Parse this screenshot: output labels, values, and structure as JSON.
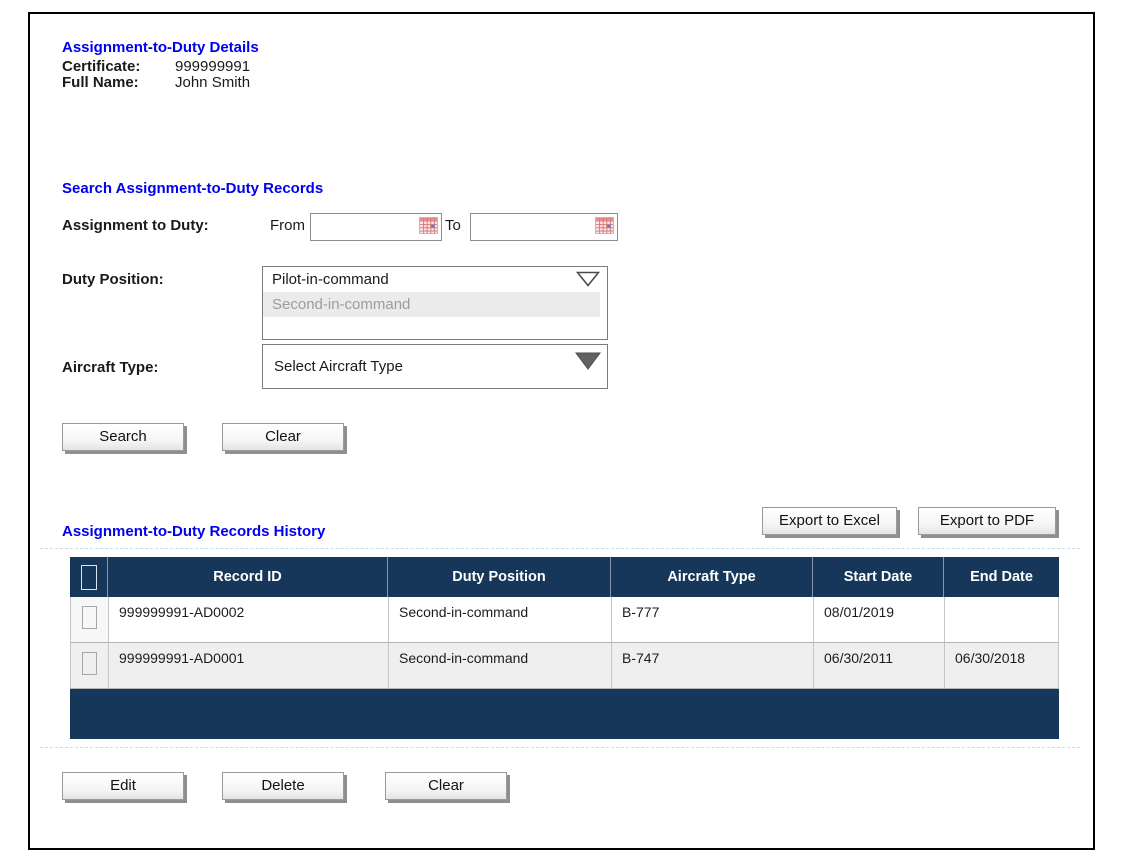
{
  "header": {
    "title": "Assignment-to-Duty Details",
    "certificate_label": "Certificate:",
    "certificate_value": "999999991",
    "full_name_label": "Full Name:",
    "full_name_value": "John Smith"
  },
  "search": {
    "heading": "Search Assignment-to-Duty Records",
    "date_label": "Assignment to Duty:",
    "from_label": "From",
    "from_value": "",
    "to_label": "To",
    "to_value": "",
    "duty_position_label": "Duty Position:",
    "duty_position_selected": "Pilot-in-command",
    "duty_position_option2": "Second-in-command",
    "aircraft_type_label": "Aircraft Type:",
    "aircraft_type_selected": "Select Aircraft Type",
    "search_button": "Search",
    "clear_button": "Clear"
  },
  "history": {
    "heading": "Assignment-to-Duty Records History",
    "export_excel_button": "Export to Excel",
    "export_pdf_button": "Export to PDF",
    "columns": [
      "Record ID",
      "Duty Position",
      "Aircraft Type",
      "Start Date",
      "End Date"
    ],
    "rows": [
      {
        "record_id": "999999991-AD0002",
        "duty_position": "Second-in-command",
        "aircraft_type": "B-777",
        "start_date": "08/01/2019",
        "end_date": ""
      },
      {
        "record_id": "999999991-AD0001",
        "duty_position": "Second-in-command",
        "aircraft_type": "B-747",
        "start_date": "06/30/2011",
        "end_date": "06/30/2018"
      }
    ],
    "edit_button": "Edit",
    "delete_button": "Delete",
    "clear_button": "Clear"
  },
  "icons": {
    "from_date": "calendar-icon",
    "to_date": "calendar-icon",
    "duty_position_arrow": "dropdown-arrow-outline-icon",
    "aircraft_type_arrow": "dropdown-arrow-filled-icon",
    "select_all": "checkbox-glyph",
    "row_select": "checkbox-glyph"
  },
  "colors": {
    "heading_blue": "#0000f0",
    "table_header_bg": "#17375a",
    "table_footer_bg": "#17375a",
    "row_alt_bg": "#efefef",
    "calendar_red": "#e98c8c",
    "calendar_blue": "#5b7fd4"
  }
}
